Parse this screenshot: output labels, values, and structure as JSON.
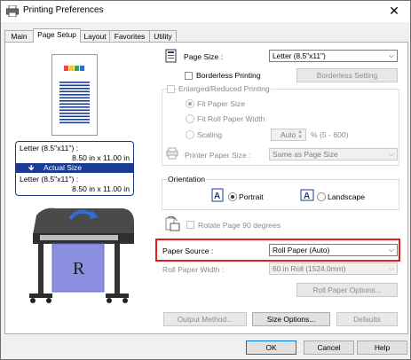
{
  "window": {
    "title": "Printing Preferences",
    "close_glyph": "✕"
  },
  "tabs": [
    "Main",
    "Page Setup",
    "Layout",
    "Favorites",
    "Utility"
  ],
  "preview": {
    "from_size": "Letter (8.5\"x11\") :",
    "from_dims": "8.50 in x 11.00 in",
    "mode": "Actual Size",
    "to_size": "Letter (8.5\"x11\") :",
    "to_dims": "8.50 in x 11.00 in",
    "printer_sheet_letter": "R",
    "arrow_glyph": "🡻"
  },
  "page_size": {
    "label": "Page Size :",
    "value": "Letter (8.5\"x11\")"
  },
  "borderless": {
    "label": "Borderless Printing",
    "checked": false,
    "button": "Borderless Setting"
  },
  "enlarged": {
    "label": "Enlarged/Reduced Printing",
    "checked": false,
    "options": [
      "Fit Paper Size",
      "Fit Roll Paper Width",
      "Scaling"
    ],
    "selected": "Fit Paper Size",
    "scaling_value": "Auto",
    "scaling_range": "% (5 - 600)"
  },
  "printer_paper_size": {
    "label": "Printer Paper Size :",
    "value": "Same as Page Size"
  },
  "orientation": {
    "title": "Orientation",
    "portrait": "Portrait",
    "landscape": "Landscape",
    "selected": "Portrait"
  },
  "rotate": {
    "label": "Rotate Page 90 degrees",
    "checked": false
  },
  "paper_source": {
    "label": "Paper Source :",
    "value": "Roll Paper (Auto)"
  },
  "roll_width": {
    "label": "Roll Paper Width :",
    "value": "60 in Roll (1524.0mm)"
  },
  "buttons": {
    "roll_options": "Roll Paper Options...",
    "output_method": "Output Method...",
    "size_options": "Size Options...",
    "defaults": "Defaults",
    "ok": "OK",
    "cancel": "Cancel",
    "help": "Help"
  },
  "colors": {
    "accent": "#1a3c92",
    "highlight": "#e0201f",
    "focus": "#0078d7"
  }
}
